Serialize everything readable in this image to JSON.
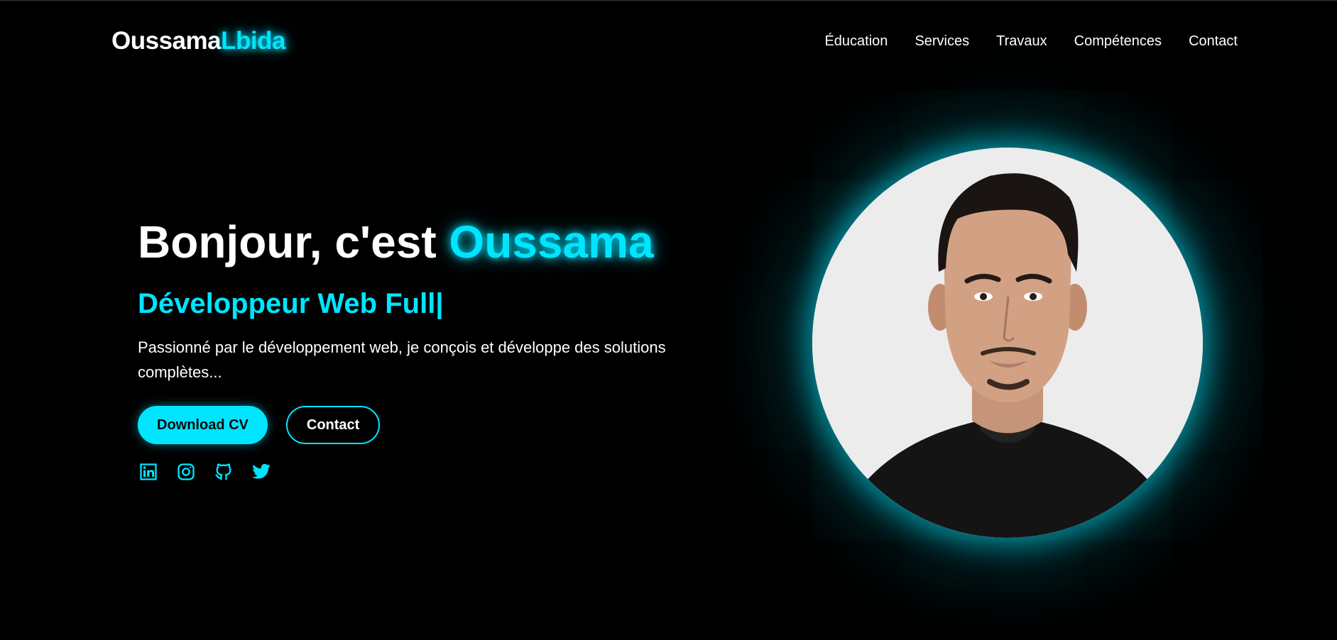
{
  "header": {
    "logo_first": "Oussama",
    "logo_last": "Lbida",
    "nav": [
      {
        "label": "Éducation"
      },
      {
        "label": "Services"
      },
      {
        "label": "Travaux"
      },
      {
        "label": "Compétences"
      },
      {
        "label": "Contact"
      }
    ]
  },
  "hero": {
    "greeting": "Bonjour, c'est ",
    "name": "Oussama",
    "subtitle": "Développeur Web Full|",
    "description": "Passionné par le développement web, je conçois et développe des solutions complètes...",
    "buttons": {
      "primary": "Download CV",
      "secondary": "Contact"
    },
    "socials": [
      {
        "icon": "linkedin-icon"
      },
      {
        "icon": "instagram-icon"
      },
      {
        "icon": "github-icon"
      },
      {
        "icon": "twitter-icon"
      }
    ]
  },
  "profile_photo": {
    "icon": "profile-photo"
  },
  "colors": {
    "background": "#000000",
    "accent": "#00e5ff",
    "text": "#ffffff"
  }
}
